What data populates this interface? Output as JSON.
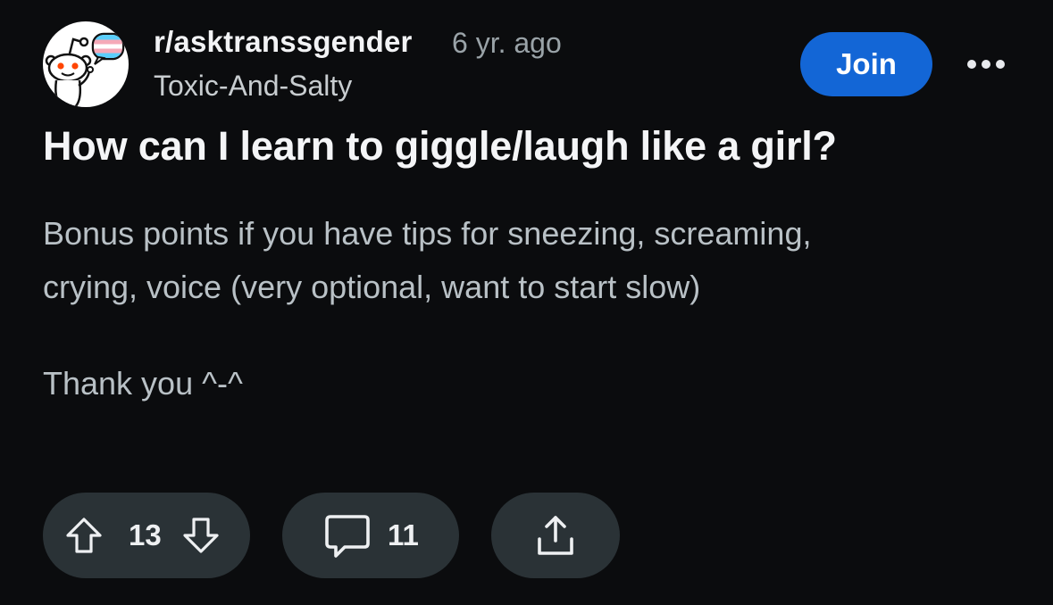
{
  "post": {
    "subreddit": "r/asktranssgender",
    "time_ago": "6 yr. ago",
    "author": "Toxic-And-Salty",
    "join_label": "Join",
    "title": "How can I learn to giggle/laugh like a girl?",
    "body": [
      "Bonus points if you have tips for sneezing, screaming,",
      "crying, voice (very optional, want to start slow)",
      "Thank you ^-^"
    ],
    "upvotes": "13",
    "comments": "11"
  },
  "colors": {
    "background": "#0b0c0e",
    "join_button": "#1366d6",
    "pill": "#2a3236",
    "body_text": "#b9c1c6"
  },
  "icons": {
    "avatar": "snoo-trans-flag-avatar",
    "more": "more-horizontal-icon",
    "upvote": "upvote-arrow-icon",
    "downvote": "downvote-arrow-icon",
    "comment": "comment-bubble-icon",
    "share": "share-icon"
  }
}
